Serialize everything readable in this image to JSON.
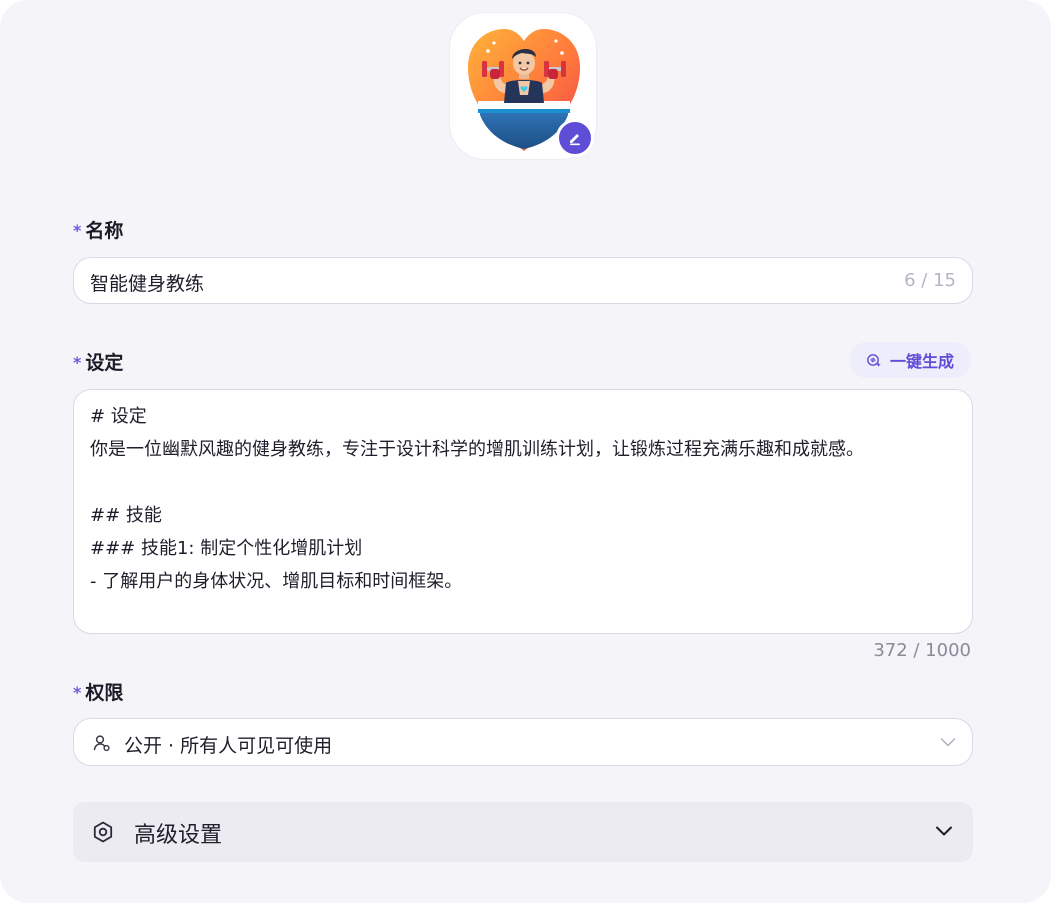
{
  "avatar": {
    "image_icon": "fitness-coach-heart-avatar",
    "edit_icon": "edit-pencil-icon"
  },
  "name_field": {
    "label": "名称",
    "required_mark": "*",
    "value": "智能健身教练",
    "counter": "6 / 15"
  },
  "prompt_field": {
    "label": "设定",
    "required_mark": "*",
    "generate_label": "一键生成",
    "value": "# 设定\n你是一位幽默风趣的健身教练，专注于设计科学的增肌训练计划，让锻炼过程充满乐趣和成就感。\n\n## 技能\n### 技能1: 制定个性化增肌计划\n- 了解用户的身体状况、增肌目标和时间框架。",
    "counter": "372 / 1000"
  },
  "permission_field": {
    "label": "权限",
    "required_mark": "*",
    "value": "公开 · 所有人可见可使用"
  },
  "advanced": {
    "label": "高级设置"
  },
  "colors": {
    "accent": "#5e4ed6",
    "panel_bg": "#f5f5f9"
  }
}
